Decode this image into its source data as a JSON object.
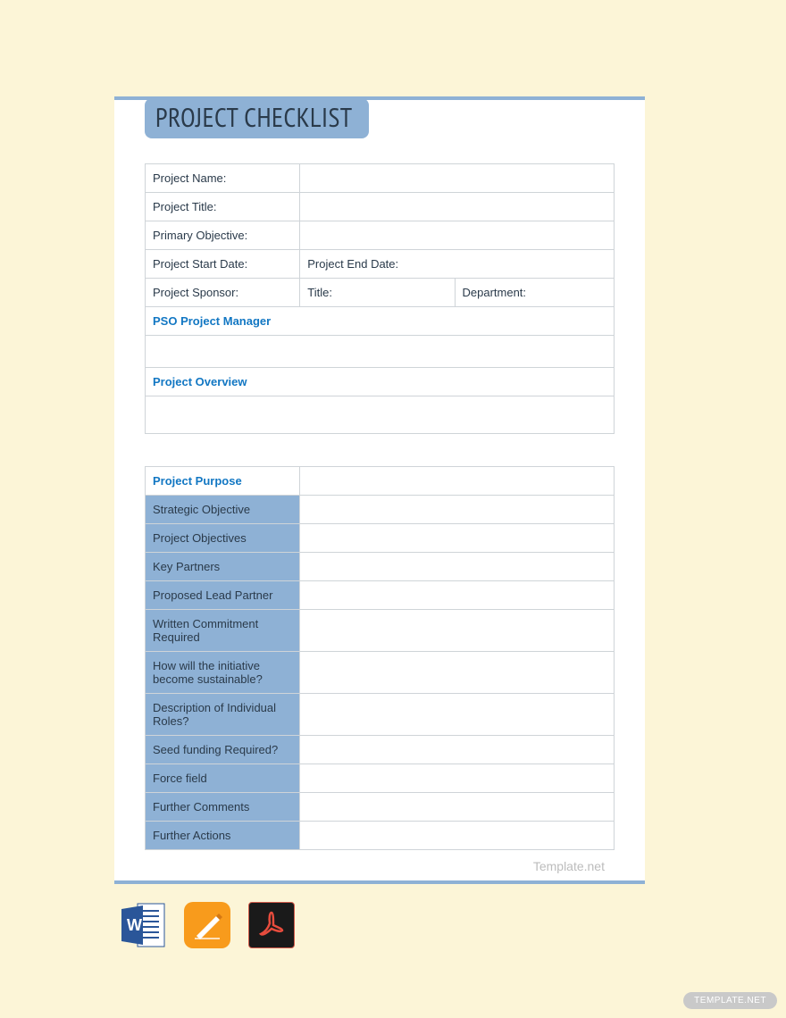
{
  "title": "PROJECT CHECKLIST",
  "table1": {
    "rows": [
      {
        "cells": [
          {
            "label": "Project Name:",
            "span": 1
          },
          {
            "label": "",
            "span": 3
          }
        ]
      },
      {
        "cells": [
          {
            "label": "Project Title:",
            "span": 1
          },
          {
            "label": "",
            "span": 3
          }
        ]
      },
      {
        "cells": [
          {
            "label": "Primary Objective:",
            "span": 1
          },
          {
            "label": "",
            "span": 3
          }
        ]
      },
      {
        "cells": [
          {
            "label": "Project Start Date:",
            "span": 1
          },
          {
            "label": "Project End Date:",
            "span": 3
          }
        ]
      },
      {
        "cells": [
          {
            "label": "Project Sponsor:",
            "span": 1
          },
          {
            "label": "Title:",
            "span": 1
          },
          {
            "label": "Department:",
            "span": 2
          }
        ]
      }
    ],
    "section1": "PSO Project Manager",
    "section2": "Project Overview"
  },
  "table2": {
    "header": "Project Purpose",
    "rows": [
      "Strategic Objective",
      "Project Objectives",
      "Key Partners",
      "Proposed Lead Partner",
      "Written Commitment Required",
      "How will the initiative become sustainable?",
      "Description of Individual Roles?",
      "Seed funding Required?",
      "Force field",
      "Further Comments",
      "Further Actions"
    ]
  },
  "watermark": "Template.net",
  "badge": "TEMPLATE.NET",
  "icons": {
    "word": "word-icon",
    "pages": "pages-icon",
    "acrobat": "acrobat-icon"
  }
}
